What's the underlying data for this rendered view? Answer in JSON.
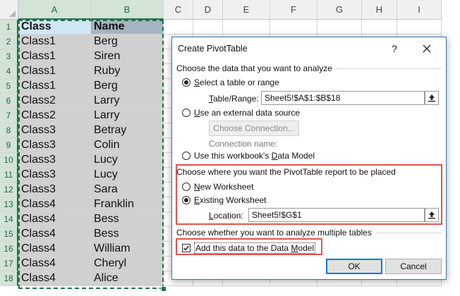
{
  "sheet": {
    "columns": [
      "A",
      "B",
      "C",
      "D",
      "E",
      "F",
      "G",
      "H",
      "I"
    ],
    "rows": [
      "1",
      "2",
      "3",
      "4",
      "5",
      "6",
      "7",
      "8",
      "9",
      "10",
      "11",
      "12",
      "13",
      "14",
      "15",
      "16",
      "17",
      "18"
    ],
    "header": {
      "a": "Class",
      "b": "Name"
    },
    "data": [
      [
        "Class1",
        "Berg"
      ],
      [
        "Class1",
        "Siren"
      ],
      [
        "Class1",
        "Ruby"
      ],
      [
        "Class1",
        "Berg"
      ],
      [
        "Class2",
        "Larry"
      ],
      [
        "Class2",
        "Larry"
      ],
      [
        "Class3",
        "Betray"
      ],
      [
        "Class3",
        "Colin"
      ],
      [
        "Class3",
        "Lucy"
      ],
      [
        "Class3",
        "Lucy"
      ],
      [
        "Class3",
        "Sara"
      ],
      [
        "Class4",
        "Franklin"
      ],
      [
        "Class4",
        "Bess"
      ],
      [
        "Class4",
        "Bess"
      ],
      [
        "Class4",
        "William"
      ],
      [
        "Class4",
        "Cheryl"
      ],
      [
        "Class4",
        "Alice"
      ]
    ]
  },
  "dialog": {
    "title": "Create PivotTable",
    "help_label": "?",
    "section1": "Choose the data that you want to analyze",
    "opt_table_pre": "S",
    "opt_table_rest": "elect a table or range",
    "table_range_label_pre": "T",
    "table_range_label_rest": "able/Range:",
    "table_range_value": "Sheet5!$A$1:$B$18",
    "opt_external_pre": "U",
    "opt_external_rest": "se an external data source",
    "choose_connection": "Choose Connection...",
    "connection_name": "Connection name:",
    "opt_model_pre": "Use this workbook's ",
    "opt_model_ak": "D",
    "opt_model_rest": "ata Model",
    "section2": "Choose where you want the PivotTable report to be placed",
    "opt_new_pre": "N",
    "opt_new_rest": "ew Worksheet",
    "opt_existing_pre": "E",
    "opt_existing_rest": "xisting Worksheet",
    "location_label_pre": "L",
    "location_label_rest": "ocation:",
    "location_value": "Sheet5!$G$1",
    "section3": "Choose whether you want to analyze multiple tables",
    "add_model_pre": "Add this data to the Data ",
    "add_model_ak": "M",
    "add_model_rest": "odel",
    "ok": "OK",
    "cancel": "Cancel"
  },
  "colors": {
    "accent": "#217346",
    "highlight": "#e0534f",
    "dialog_border": "#2b78c5"
  }
}
